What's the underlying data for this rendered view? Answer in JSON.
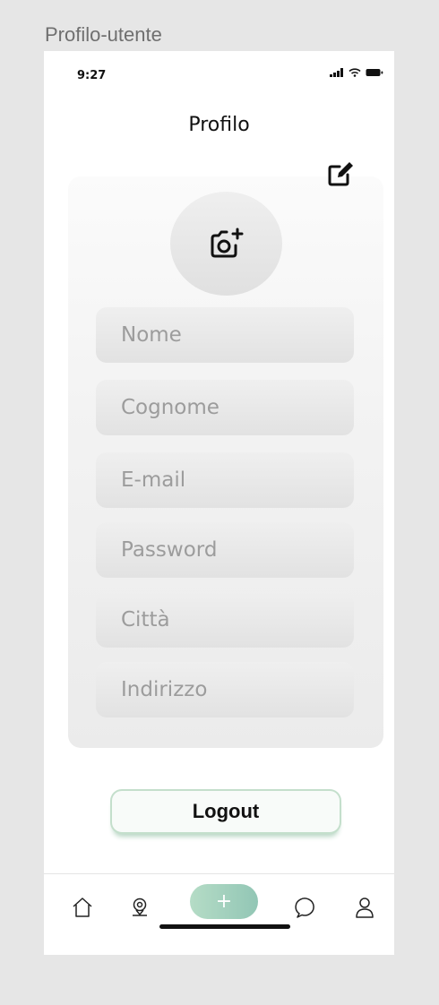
{
  "frame_label": "Profilo-utente",
  "status_bar": {
    "time": "9:27"
  },
  "header": {
    "title": "Profilo"
  },
  "form": {
    "fields": [
      {
        "placeholder": "Nome"
      },
      {
        "placeholder": "Cognome"
      },
      {
        "placeholder": "E-mail"
      },
      {
        "placeholder": "Password"
      },
      {
        "placeholder": "Città"
      },
      {
        "placeholder": "Indirizzo"
      }
    ]
  },
  "logout_label": "Logout",
  "tabbar": {
    "items": [
      "home-icon",
      "map-pin-icon",
      "add-button",
      "chat-icon",
      "user-icon"
    ],
    "add_label": "+"
  },
  "colors": {
    "accent": "#a7d3bf",
    "logout_border": "#c4dfcc"
  }
}
